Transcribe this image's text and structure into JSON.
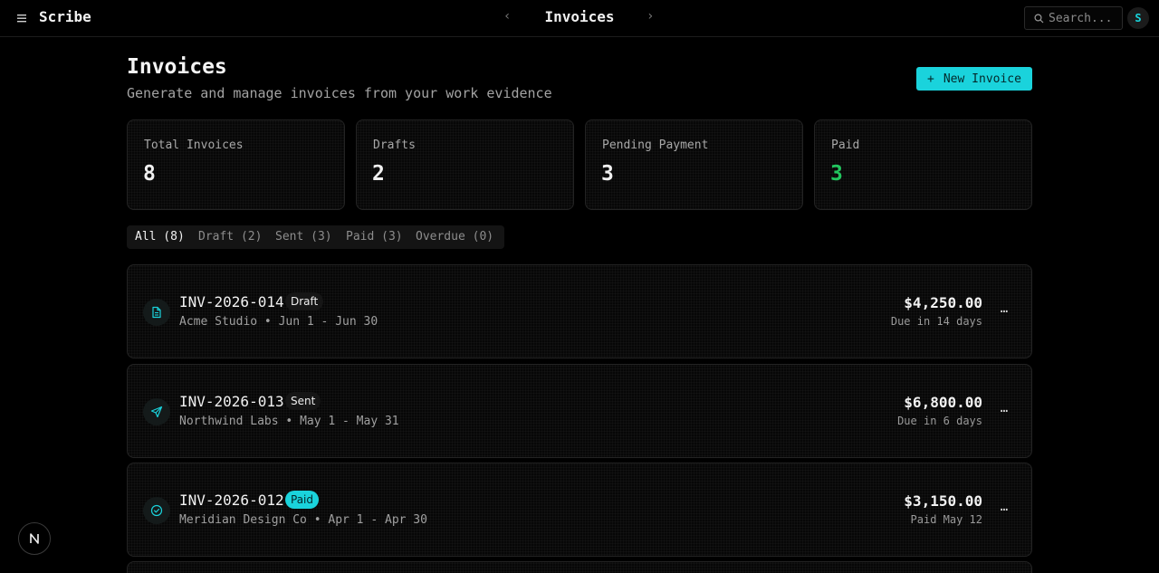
{
  "app": {
    "brand": "Scribe"
  },
  "topbar": {
    "title": "Invoices",
    "prev": "‹",
    "next": "›",
    "search_placeholder": "Search...",
    "avatar_initial": "S"
  },
  "page": {
    "title": "Invoices",
    "subtitle": "Generate and manage invoices from your work evidence",
    "new_button": "New Invoice",
    "new_button_icon": "+"
  },
  "stats": [
    {
      "label": "Total Invoices",
      "value": "8",
      "color": "#f0f0f0"
    },
    {
      "label": "Drafts",
      "value": "2",
      "color": "#f0f0f0"
    },
    {
      "label": "Pending Payment",
      "value": "3",
      "color": "#f0f0f0"
    },
    {
      "label": "Paid",
      "value": "3",
      "color": "#22c55e"
    }
  ],
  "tabs": [
    {
      "label": "All (8)",
      "active": true
    },
    {
      "label": "Draft (2)",
      "active": false
    },
    {
      "label": "Sent (3)",
      "active": false
    },
    {
      "label": "Paid (3)",
      "active": false
    },
    {
      "label": "Overdue (0)",
      "active": false
    }
  ],
  "invoices": [
    {
      "number": "INV-2026-014",
      "status": "Draft",
      "client": "Acme Studio",
      "period": "Jun 1 - Jun 30",
      "amount": "$4,250.00",
      "due": "Due in 14 days",
      "icon": "document-icon"
    },
    {
      "number": "INV-2026-013",
      "status": "Sent",
      "client": "Northwind Labs",
      "period": "May 1 - May 31",
      "amount": "$6,800.00",
      "due": "Due in 6 days",
      "icon": "send-icon"
    },
    {
      "number": "INV-2026-012",
      "status": "Paid",
      "client": "Meridian Design Co",
      "period": "Apr 1 - Apr 30",
      "amount": "$3,150.00",
      "due": "Paid May 12",
      "icon": "check-circle-icon"
    }
  ],
  "separator": "•",
  "more_label": "…",
  "colors": {
    "accent": "#1ad3dc",
    "paid_green": "#22c55e"
  }
}
